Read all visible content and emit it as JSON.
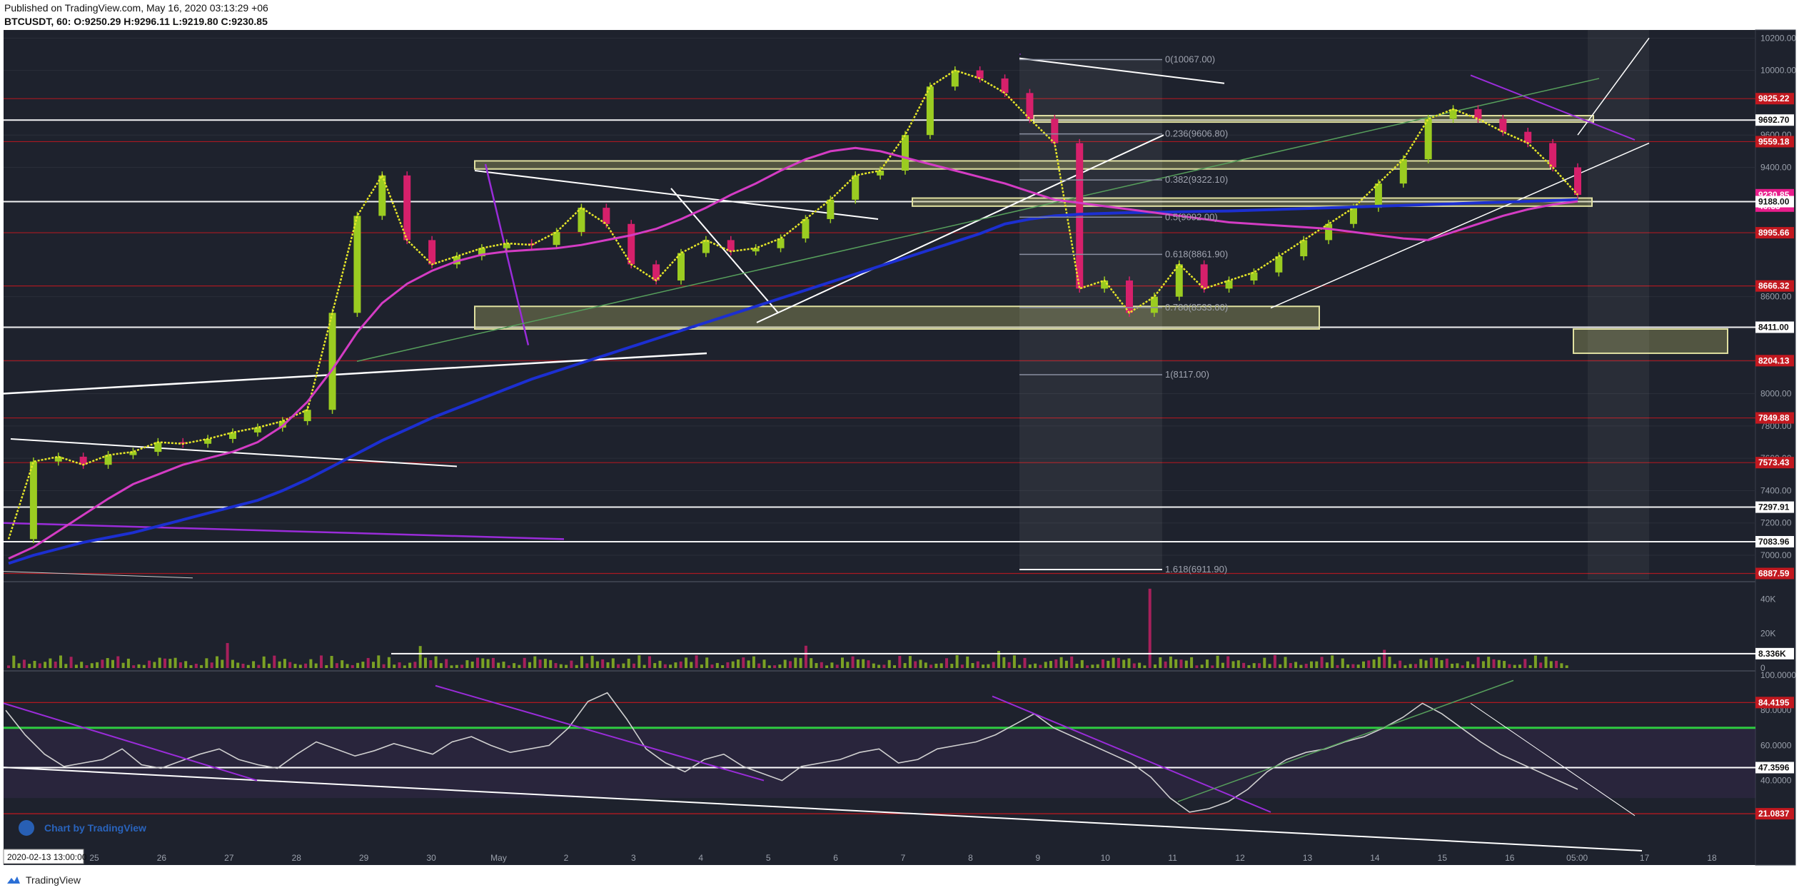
{
  "header": {
    "published": "Published on TradingView.com, May 16, 2020 03:13:29 +06",
    "symbol": "BTCUSDT, 60",
    "ohlc": "O:9250.29 H:9296.11 L:9219.80 C:9230.85"
  },
  "footer": {
    "brand": "TradingView"
  },
  "watermark": "Chart by TradingView",
  "start_date_label": "2020-02-13 13:00:00",
  "colors": {
    "background": "#1e222d",
    "price_tag_red": "#c2181f",
    "price_tag_white": "#ffffff",
    "current_price": "#e91e8c",
    "sma_blue": "#1c2fd1",
    "ema_magenta": "#d43cc4",
    "sma_yellow": "#e6e629",
    "ma_orange": "#c99a3a",
    "rsi_line": "#d0d0d0",
    "rsi_green_level": "#2ecc40",
    "candle_up": "#9bcc21",
    "candle_down": "#d6206b",
    "zone_fill": "#b5b566"
  },
  "chart_data": [
    {
      "type": "candlestick",
      "symbol": "BTCUSDT",
      "interval": "60",
      "x_ticks": [
        "25",
        "26",
        "27",
        "28",
        "29",
        "30",
        "May",
        "2",
        "3",
        "4",
        "5",
        "6",
        "7",
        "8",
        "9",
        "10",
        "11",
        "12",
        "13",
        "14",
        "15",
        "16",
        "05:00",
        "17",
        "18"
      ],
      "y_ticks": [
        "10200.00",
        "10000.00",
        "9600.00",
        "9400.00",
        "8600.00",
        "8400.00",
        "8200.00",
        "8000.00",
        "7800.00",
        "7600.00",
        "7400.00",
        "7200.00",
        "7000.00"
      ],
      "y_range": [
        6850,
        10250
      ],
      "price_tags": [
        {
          "value": "9825.22",
          "style": "red"
        },
        {
          "value": "9692.70",
          "style": "white"
        },
        {
          "value": "9559.18",
          "style": "red"
        },
        {
          "value": "9230.85",
          "style": "current"
        },
        {
          "value": "46:33",
          "style": "current"
        },
        {
          "value": "9188.00",
          "style": "white"
        },
        {
          "value": "8995.66",
          "style": "red"
        },
        {
          "value": "8666.32",
          "style": "red"
        },
        {
          "value": "8411.00",
          "style": "white"
        },
        {
          "value": "8204.13",
          "style": "red"
        },
        {
          "value": "7849.88",
          "style": "red"
        },
        {
          "value": "7573.43",
          "style": "red"
        },
        {
          "value": "7297.91",
          "style": "white"
        },
        {
          "value": "7083.96",
          "style": "white"
        },
        {
          "value": "6887.59",
          "style": "red"
        }
      ],
      "fib_levels": [
        {
          "label": "0(10067.00)",
          "value": 10067.0
        },
        {
          "label": "0.236(9606.80)",
          "value": 9606.8
        },
        {
          "label": "0.382(9322.10)",
          "value": 9322.1
        },
        {
          "label": "0.5(9092.00)",
          "value": 9092.0
        },
        {
          "label": "0.618(8861.90)",
          "value": 8861.9
        },
        {
          "label": "0.786(8533.00)",
          "value": 8533.0
        },
        {
          "label": "1(8117.00)",
          "value": 8117.0
        },
        {
          "label": "1.618(6911.90)",
          "value": 6911.9
        }
      ],
      "close_series": [
        7100,
        7580,
        7610,
        7560,
        7620,
        7640,
        7700,
        7690,
        7720,
        7760,
        7790,
        7830,
        7900,
        8500,
        9100,
        9350,
        8950,
        8800,
        8850,
        8900,
        8930,
        8920,
        9000,
        9150,
        9050,
        8800,
        8700,
        8870,
        8950,
        8880,
        8900,
        8960,
        9080,
        9200,
        9350,
        9380,
        9600,
        9900,
        10000,
        9950,
        9860,
        9700,
        9550,
        8650,
        8700,
        8500,
        8600,
        8800,
        8650,
        8700,
        8750,
        8850,
        8950,
        9050,
        9150,
        9300,
        9450,
        9700,
        9760,
        9700,
        9620,
        9550,
        9400,
        9230
      ],
      "moving_averages": [
        {
          "color": "blue",
          "values": [
            6950,
            7000,
            7040,
            7080,
            7110,
            7140,
            7180,
            7220,
            7260,
            7300,
            7340,
            7400,
            7470,
            7550,
            7630,
            7710,
            7780,
            7850,
            7910,
            7970,
            8030,
            8090,
            8140,
            8190,
            8240,
            8290,
            8340,
            8390,
            8440,
            8490,
            8540,
            8590,
            8640,
            8690,
            8740,
            8790,
            8840,
            8890,
            8940,
            8990,
            9050,
            9080,
            9100,
            9110,
            9115,
            9120,
            9122,
            9125,
            9128,
            9130,
            9135,
            9140,
            9145,
            9150,
            9155,
            9160,
            9165,
            9170,
            9175,
            9180,
            9185,
            9190,
            9195,
            9200
          ]
        },
        {
          "color": "magenta",
          "values": [
            6980,
            7050,
            7150,
            7250,
            7350,
            7440,
            7500,
            7560,
            7600,
            7640,
            7700,
            7800,
            7950,
            8150,
            8380,
            8560,
            8680,
            8760,
            8820,
            8860,
            8880,
            8890,
            8900,
            8920,
            8950,
            8980,
            9020,
            9080,
            9150,
            9230,
            9300,
            9380,
            9450,
            9500,
            9520,
            9500,
            9460,
            9420,
            9380,
            9340,
            9300,
            9250,
            9200,
            9180,
            9160,
            9140,
            9120,
            9100,
            9080,
            9060,
            9050,
            9040,
            9030,
            9020,
            9000,
            8980,
            8960,
            8950,
            9000,
            9050,
            9100,
            9140,
            9170,
            9190
          ]
        }
      ]
    },
    {
      "type": "bar",
      "name": "Volume",
      "y_ticks": [
        "40K",
        "20K",
        "0"
      ],
      "reference_label": "8.336K",
      "y_range": [
        0,
        48000
      ]
    },
    {
      "type": "line",
      "name": "RSI",
      "y_ticks": [
        "100.0000",
        "80.0000",
        "60.0000",
        "40.0000"
      ],
      "level_tags": [
        {
          "value": "84.4195",
          "style": "red"
        },
        {
          "value": "47.3596",
          "style": "white"
        },
        {
          "value": "21.0837",
          "style": "red"
        }
      ],
      "y_range": [
        0,
        100
      ],
      "values": [
        80,
        66,
        55,
        48,
        50,
        52,
        58,
        49,
        47,
        51,
        55,
        58,
        52,
        49,
        47,
        55,
        62,
        58,
        54,
        57,
        61,
        58,
        55,
        62,
        65,
        60,
        56,
        58,
        60,
        70,
        85,
        90,
        75,
        58,
        50,
        45,
        52,
        55,
        48,
        44,
        40,
        48,
        50,
        52,
        56,
        58,
        50,
        52,
        58,
        60,
        62,
        66,
        72,
        78,
        70,
        65,
        60,
        55,
        50,
        42,
        30,
        22,
        24,
        28,
        35,
        45,
        52,
        56,
        58,
        62,
        65,
        70,
        76,
        84,
        78,
        70,
        62,
        55,
        50,
        45,
        40,
        35
      ]
    }
  ]
}
